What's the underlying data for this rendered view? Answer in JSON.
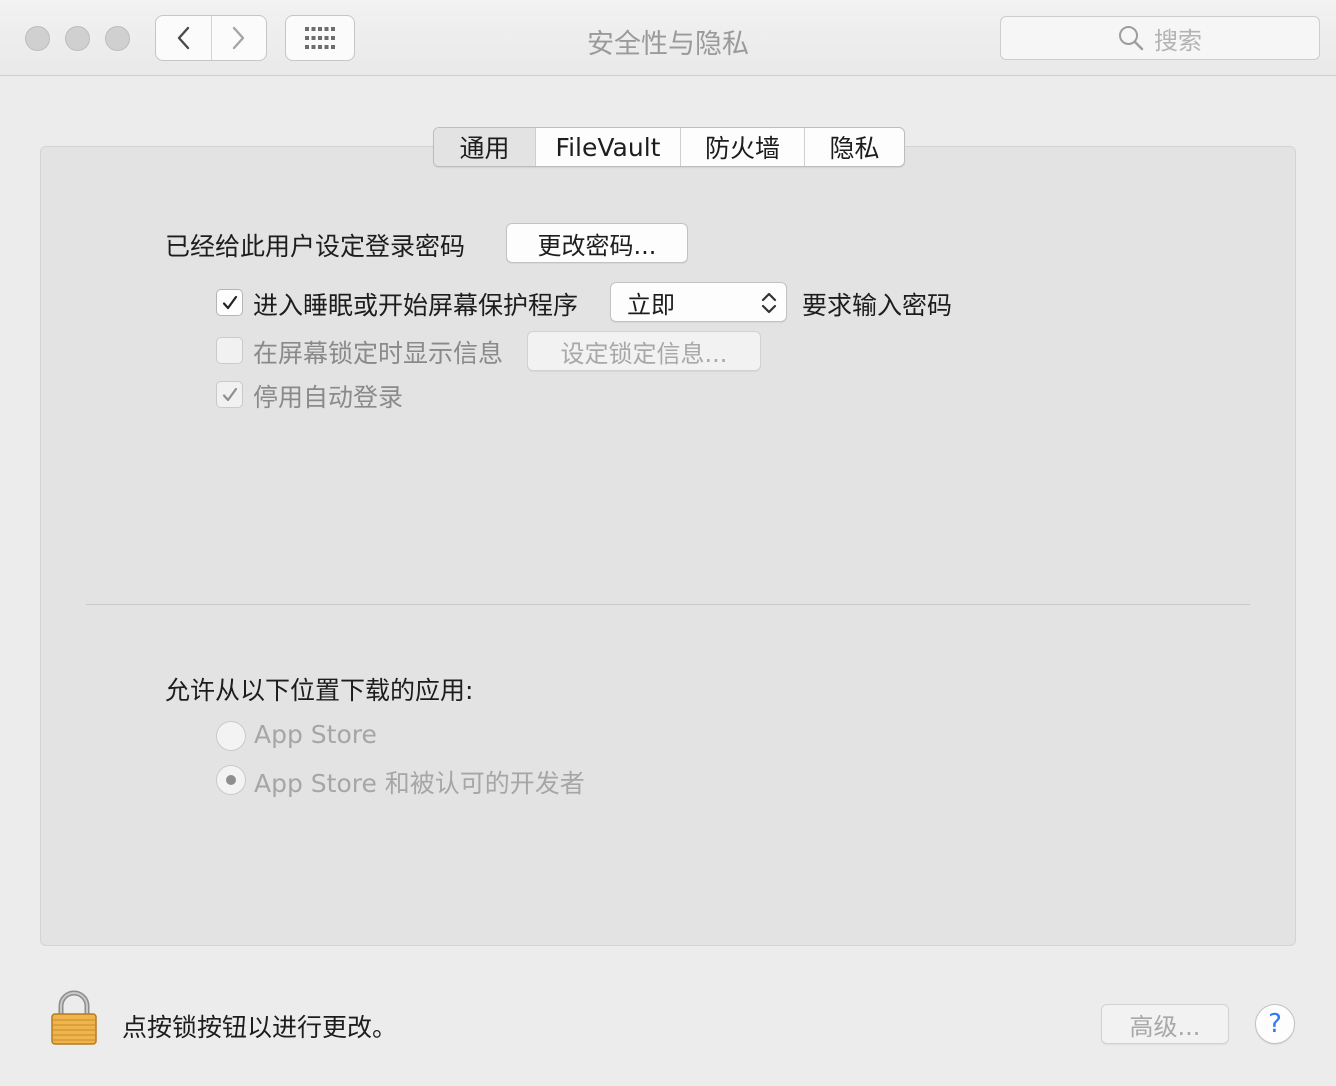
{
  "window": {
    "title": "安全性与隐私",
    "search_placeholder": "搜索"
  },
  "tabs": [
    {
      "label": "通用",
      "selected": true
    },
    {
      "label": "FileVault",
      "selected": false
    },
    {
      "label": "防火墙",
      "selected": false
    },
    {
      "label": "隐私",
      "selected": false
    }
  ],
  "general": {
    "password_set_label": "已经给此用户设定登录密码",
    "change_password_button": "更改密码...",
    "require_password": {
      "checked": true,
      "label": "进入睡眠或开始屏幕保护程序",
      "delay_value": "立即",
      "suffix": "要求输入密码"
    },
    "lock_message": {
      "checked": false,
      "label": "在屏幕锁定时显示信息",
      "button": "设定锁定信息..."
    },
    "disable_auto_login": {
      "checked": true,
      "label": "停用自动登录"
    }
  },
  "downloads": {
    "title": "允许从以下位置下载的应用:",
    "options": [
      {
        "label": "App Store",
        "selected": false
      },
      {
        "label": "App Store 和被认可的开发者",
        "selected": true
      }
    ]
  },
  "footer": {
    "lock_text": "点按锁按钮以进行更改。",
    "advanced_button": "高级...",
    "help_label": "?"
  },
  "colors": {
    "help_accent": "#3478f6",
    "lock_gold": "#f0b44c"
  }
}
